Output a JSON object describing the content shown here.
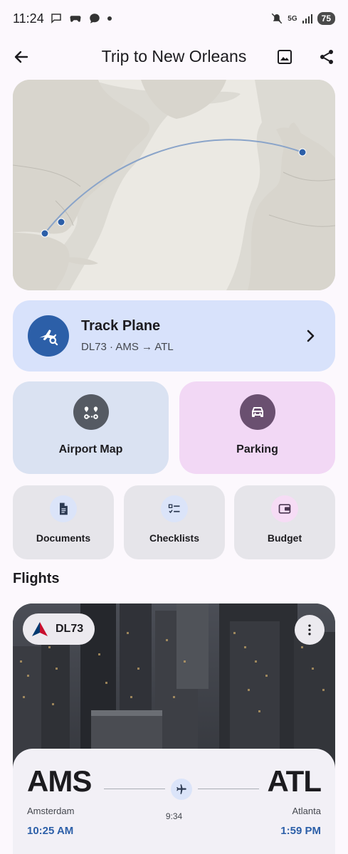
{
  "status_bar": {
    "time": "11:24",
    "battery": "75",
    "network": "5G"
  },
  "header": {
    "title": "Trip to New Orleans"
  },
  "track_plane": {
    "title": "Track Plane",
    "subtitle": "DL73 · AMS → ATL"
  },
  "quick_actions": {
    "airport_map": "Airport Map",
    "parking": "Parking",
    "documents": "Documents",
    "checklists": "Checklists",
    "budget": "Budget"
  },
  "flights": {
    "section_title": "Flights",
    "flight_number": "DL73",
    "from_code": "AMS",
    "from_city": "Amsterdam",
    "from_time": "10:25 AM",
    "to_code": "ATL",
    "to_city": "Atlanta",
    "to_time": "1:59 PM",
    "duration": "9:34"
  },
  "colors": {
    "accent": "#2c5fa8",
    "track_bg": "#d8e2fb",
    "parking_bg": "#f2d8f5"
  }
}
